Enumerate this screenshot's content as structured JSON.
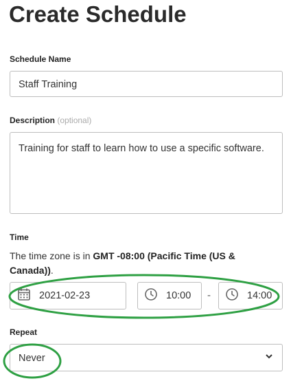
{
  "page": {
    "title": "Create Schedule"
  },
  "schedule_name": {
    "label": "Schedule Name",
    "value": "Staff Training"
  },
  "description": {
    "label": "Description",
    "optional": "(optional)",
    "value": "Training for staff to learn how to use a specific software."
  },
  "time": {
    "label": "Time",
    "tz_prefix": "The time zone is in ",
    "tz_value": "GMT -08:00 (Pacific Time (US & Canada))",
    "tz_suffix": ".",
    "date": "2021-02-23",
    "start": "10:00",
    "separator": "-",
    "end": "14:00"
  },
  "repeat": {
    "label": "Repeat",
    "value": "Never"
  },
  "icons": {
    "date": "calendar-icon",
    "time": "clock-icon",
    "dropdown": "chevron-down-icon"
  },
  "colors": {
    "annotation": "#2ea043",
    "border": "#bdbdbd",
    "optional_text": "#aaaaaa"
  }
}
